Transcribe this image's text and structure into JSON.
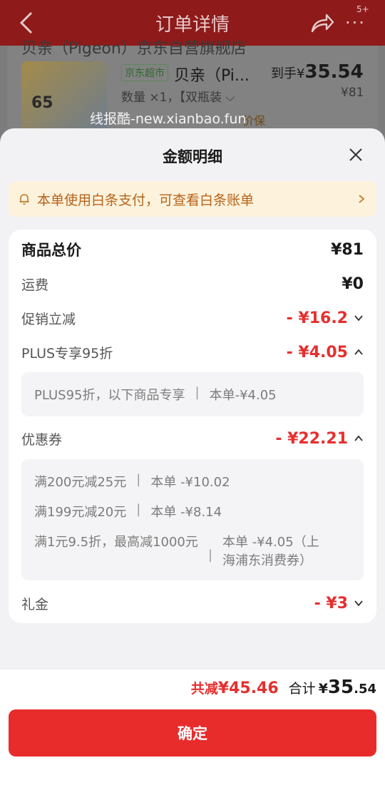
{
  "background": {
    "title": "订单详情",
    "badge": "5+",
    "more_icon": "···",
    "shop_name": "贝亲（Pigeon）京东自营旗舰店",
    "image_badge": "65",
    "tag": "京东超市",
    "product_name": "贝亲（Pi...",
    "price_prefix": "到手¥",
    "price_value": "35.54",
    "quantity": "数量 ×1，【双瓶装 ⌵",
    "original_price": "¥81",
    "guarantee": "价保",
    "watermark": "线报酷-new.xianbao.fun"
  },
  "sheet": {
    "title": "金额明细",
    "notice": "本单使用白条支付，可查看白条账单",
    "rows": {
      "total": {
        "label": "商品总价",
        "amount": "¥81"
      },
      "shipping": {
        "label": "运费",
        "amount": "¥0"
      },
      "promo": {
        "label": "促销立减",
        "amount": "- ¥16.2"
      },
      "plus": {
        "label": "PLUS专享95折",
        "amount": "- ¥4.05"
      },
      "coupon": {
        "label": "优惠券",
        "amount": "- ¥22.21"
      },
      "gift": {
        "label": "礼金",
        "amount": "- ¥3"
      }
    },
    "plus_detail": {
      "desc": "PLUS95折，以下商品专享",
      "value": "本单-¥4.05"
    },
    "coupon_details": [
      {
        "desc": "满200元减25元",
        "value": "本单 -¥10.02"
      },
      {
        "desc": "满199元减20元",
        "value": "本单 -¥8.14"
      },
      {
        "desc": "满1元9.5折，最高减1000元",
        "value_line1": "本单 -¥4.05（上",
        "value_line2": "海浦东消费券）"
      }
    ],
    "separator": "|"
  },
  "footer": {
    "saved_label": "共减",
    "saved_amount": "¥45.46",
    "total_label": "合计",
    "currency": "¥",
    "total_int": "35",
    "total_dec": ".54",
    "confirm_label": "确定"
  },
  "colors": {
    "accent_red": "#e62f2f",
    "notice_bg": "#fdf2dc",
    "notice_text": "#b5641a"
  }
}
